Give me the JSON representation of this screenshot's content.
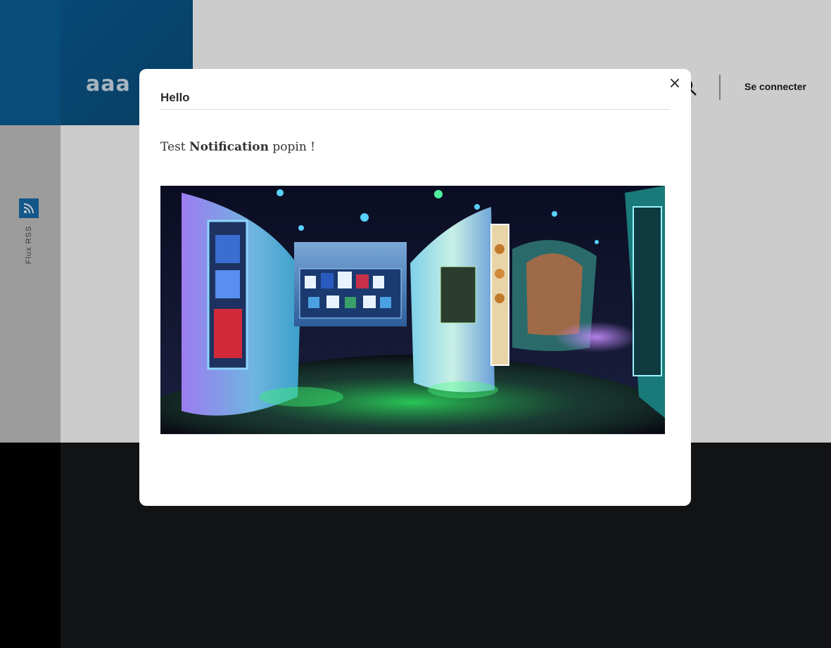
{
  "header": {
    "logo_text": "aaa",
    "login_label": "Se connecter"
  },
  "sidebar": {
    "rss_label": "Flux RSS"
  },
  "modal": {
    "title": "Hello",
    "body_prefix": "Test ",
    "body_bold": "Notification",
    "body_suffix": " popin !",
    "close_glyph": "×",
    "image_description": "museum-gallery-panorama"
  },
  "colors": {
    "brand_blue": "#1a6fae",
    "overlay": "rgba(0,0,0,0.2)",
    "footer": "#16181b"
  },
  "icons": {
    "rss": "rss-icon",
    "search": "search-icon",
    "close": "close-icon"
  }
}
